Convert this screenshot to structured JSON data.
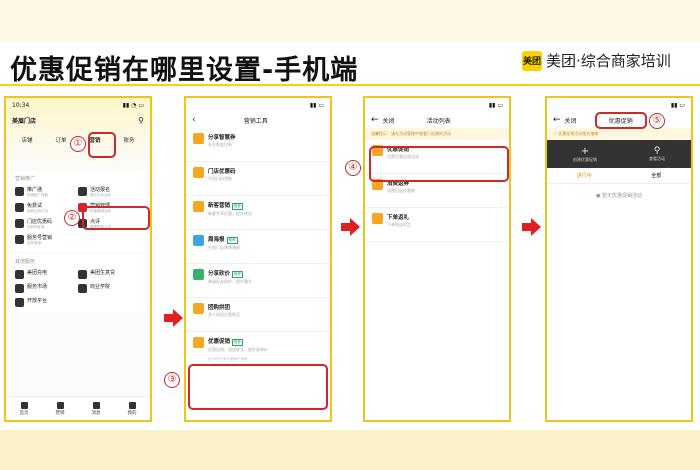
{
  "page": {
    "title": "优惠促销在哪里设置-手机端",
    "brand_logo": "美团",
    "brand_text": "美团·综合商家培训",
    "accent_color": "#ffd100",
    "highlight_color": "#d02828",
    "arrow_color": "#e02020"
  },
  "steps": [
    "①",
    "②",
    "③",
    "④",
    "⑤"
  ],
  "phone1": {
    "time": "10:34",
    "store": "美眉门店",
    "tabs": [
      "店铺",
      "订单",
      "营销",
      "账务"
    ],
    "section1": "营销推广",
    "items": [
      {
        "title": "推广通",
        "desc": "快速推广获客",
        "icon": "megaphone-icon"
      },
      {
        "title": "活动报名",
        "desc": "报名平台活动",
        "icon": "flag-icon",
        "badge": "新"
      },
      {
        "title": "免费试",
        "desc": "免费试用引流",
        "icon": "gift-icon"
      },
      {
        "title": "营销管理",
        "desc": "设置营销活动",
        "icon": "settings-icon"
      },
      {
        "title": "门店优惠码",
        "desc": "扫码领优惠",
        "icon": "qrcode-icon"
      },
      {
        "title": "点评",
        "desc": "管理顾客点评",
        "icon": "star-icon"
      },
      {
        "title": "服务号营销",
        "desc": "会员营销",
        "icon": "message-icon"
      }
    ],
    "section2": "其他服务",
    "items2": [
      {
        "title": "美团充电",
        "desc": "",
        "icon": "battery-icon"
      },
      {
        "title": "美团生意贷",
        "desc": "",
        "icon": "wallet-icon"
      },
      {
        "title": "服务市场",
        "desc": "",
        "icon": "store-icon"
      },
      {
        "title": "商业学院",
        "desc": "",
        "icon": "book-icon"
      },
      {
        "title": "开放平台",
        "desc": "",
        "icon": "grid-icon"
      }
    ],
    "tabbar": [
      "首页",
      "营销",
      "消息",
      "我的"
    ]
  },
  "phone2": {
    "header": "营销工具",
    "items": [
      {
        "title": "分享智慧券",
        "desc": "社交裂变拉新",
        "icon": "share-icon",
        "color": "#f5a623"
      },
      {
        "title": "门店优惠码",
        "desc": "手机扫码领取",
        "icon": "qrcode-icon",
        "color": "#f5a623"
      },
      {
        "title": "新客营销",
        "desc": "新客专享优惠，提升转化",
        "icon": "user-icon",
        "color": "#f5a623",
        "tag": "推荐"
      },
      {
        "title": "周海报",
        "desc": "生成门店营销海报",
        "icon": "poster-icon",
        "color": "#3aa6e8",
        "tag": "推荐"
      },
      {
        "title": "分享砍价",
        "desc": "邀请好友砍价，提升曝光",
        "icon": "share-icon",
        "color": "#34b36b",
        "tag": "推荐"
      },
      {
        "title": "团购拼团",
        "desc": "多人成团优惠购买",
        "icon": "group-icon",
        "color": "#f5a623"
      },
      {
        "title": "优惠促销",
        "desc": "优惠促销，进店转化，提升客单价",
        "icon": "coupon-icon",
        "color": "#f5a623",
        "tag": "推荐"
      }
    ],
    "note": "近30天已有大量商户使用"
  },
  "phone3": {
    "back": "关闭",
    "header": "活动列表",
    "notice": "温馨提示：请在活动管理中查看已创建的活动",
    "items": [
      {
        "title": "优惠促销",
        "desc": "设置优惠促销活动",
        "icon": "coupon-icon",
        "color": "#f5a623"
      },
      {
        "title": "消费返券",
        "desc": "消费后返优惠券",
        "icon": "ticket-icon",
        "color": "#f5a623"
      },
      {
        "title": "下单返礼",
        "desc": "下单即送礼品",
        "icon": "gift-icon",
        "color": "#f5a623"
      }
    ]
  },
  "phone4": {
    "back": "关闭",
    "header": "优惠促销",
    "notice": "优惠促销活动报名指南",
    "actions": [
      {
        "label": "创建优惠促销",
        "icon": "plus-icon"
      },
      {
        "label": "查看活动",
        "icon": "search-icon"
      }
    ],
    "subtabs": [
      "进行中",
      "全部"
    ],
    "empty": "暂无优惠促销活动"
  }
}
